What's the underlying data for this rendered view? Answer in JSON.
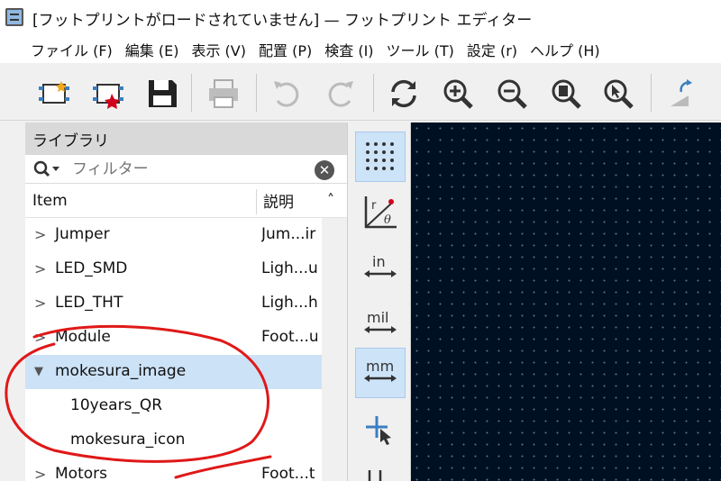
{
  "window": {
    "title": "[フットプリントがロードされていません] — フットプリント エディター"
  },
  "menu": [
    "ファイル (F)",
    "編集 (E)",
    "表示 (V)",
    "配置 (P)",
    "検査 (I)",
    "ツール (T)",
    "設定 (r)",
    "ヘルプ (H)"
  ],
  "toolbar": {
    "icons": [
      "new-footprint-icon",
      "create-footprint-icon",
      "save-icon",
      "print-icon",
      "undo-icon",
      "redo-icon",
      "refresh-icon",
      "zoom-in-icon",
      "zoom-out-icon",
      "zoom-fit-icon",
      "zoom-selection-icon",
      "mirror-icon"
    ]
  },
  "library": {
    "header": "ライブラリ",
    "filter_placeholder": "フィルター",
    "columns": {
      "item": "Item",
      "desc": "説明"
    },
    "rows": [
      {
        "name": "Jumper",
        "desc": "Jum...ir",
        "expanded": false
      },
      {
        "name": "LED_SMD",
        "desc": "Ligh...u",
        "expanded": false
      },
      {
        "name": "LED_THT",
        "desc": "Ligh...h",
        "expanded": false
      },
      {
        "name": "Module",
        "desc": "Foot...u",
        "expanded": false
      },
      {
        "name": "mokesura_image",
        "desc": "",
        "expanded": true
      },
      {
        "name": "10years_QR",
        "desc": "",
        "child": true
      },
      {
        "name": "mokesura_icon",
        "desc": "",
        "child": true
      },
      {
        "name": "Motors",
        "desc": "Foot...t",
        "expanded": false
      }
    ]
  },
  "vtools": {
    "in_label": "in",
    "mil_label": "mil",
    "mm_label": "mm",
    "r_label": "r",
    "theta_label": "θ"
  },
  "colors": {
    "accent": "#cce2f7",
    "canvas": "#001023",
    "annotation": "#e01818"
  }
}
